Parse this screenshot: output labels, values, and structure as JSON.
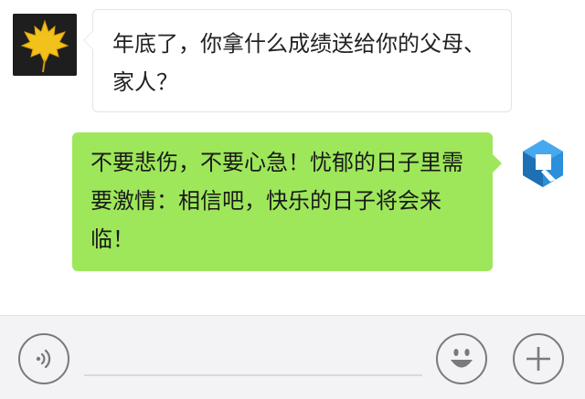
{
  "chat": {
    "incoming": {
      "text": "年底了，你拿什么成绩送给你的父母、家人？"
    },
    "outgoing": {
      "text": "不要悲伤，不要心急！忧郁的日子里需要激情：相信吧，快乐的日子将会来临！"
    }
  },
  "input_bar": {
    "voice_icon": "voice-icon",
    "emoji_icon": "emoji-icon",
    "plus_icon": "plus-icon",
    "message_value": ""
  },
  "colors": {
    "outgoing_bubble": "#9ee75b",
    "incoming_bubble": "#ffffff",
    "input_bar_bg": "#f3f3f5",
    "icon_stroke": "#7a7a7a"
  }
}
